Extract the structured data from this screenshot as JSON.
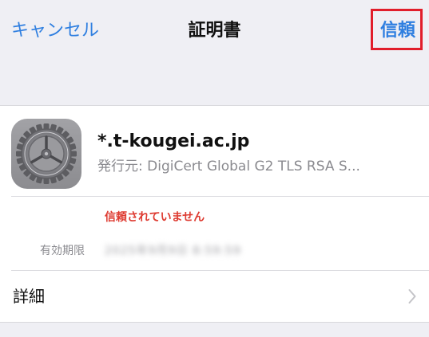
{
  "nav": {
    "cancel_label": "キャンセル",
    "title": "証明書",
    "trust_label": "信頼"
  },
  "certificate": {
    "icon": "gear-icon",
    "name": "*.t-kougei.ac.jp",
    "issuer": "発行元: DigiCert Global G2 TLS RSA S...",
    "status": "信頼されていません",
    "expiry_label": "有効期限",
    "expiry_value": "2025年9月9日 8:59:59"
  },
  "details": {
    "label": "詳細",
    "chevron_icon": "chevron-right-icon"
  },
  "colors": {
    "accent": "#2f7fe0",
    "warning": "#de3a30",
    "highlight_box": "#e11e2b",
    "background": "#efeff4"
  }
}
